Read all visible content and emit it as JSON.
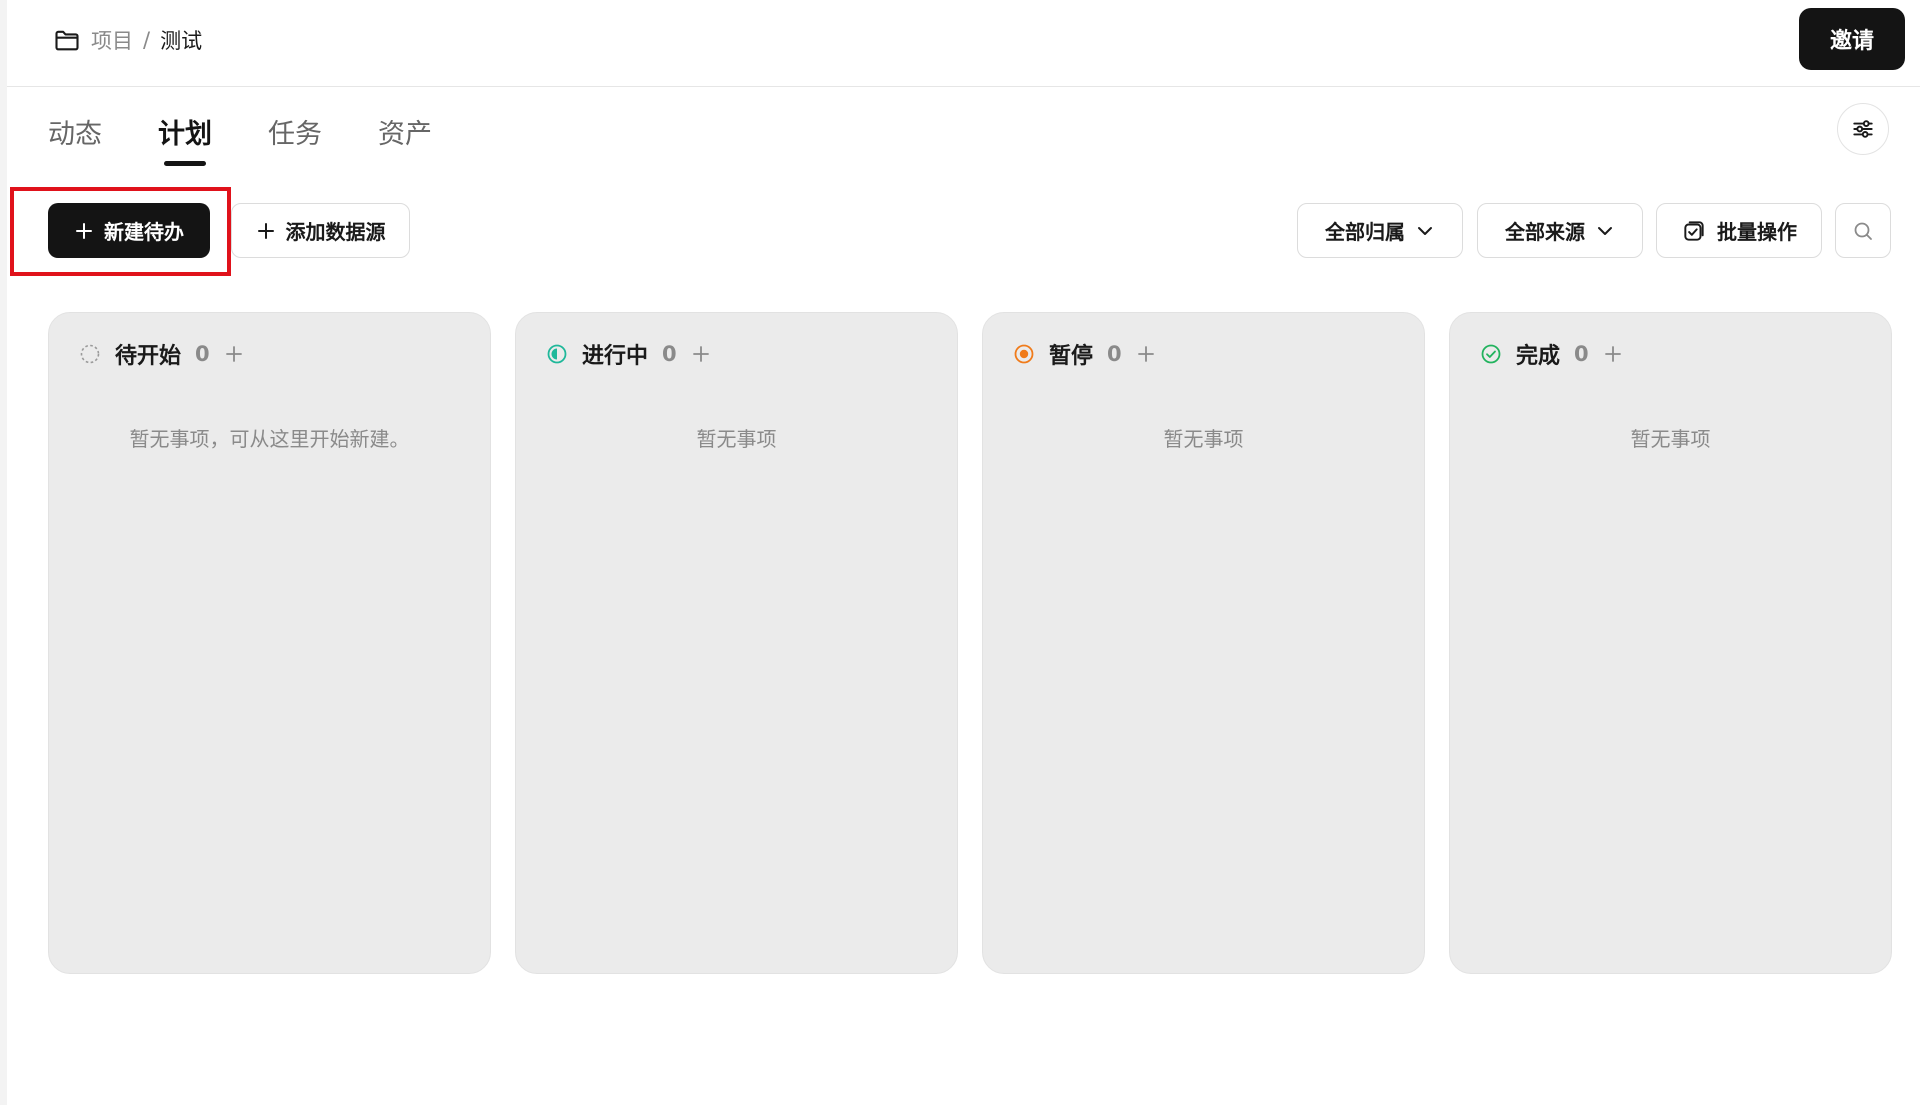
{
  "breadcrumb": {
    "root": "项目",
    "separator": "/",
    "current": "测试"
  },
  "header": {
    "invite_label": "邀请"
  },
  "tabs": [
    {
      "label": "动态",
      "active": false
    },
    {
      "label": "计划",
      "active": true
    },
    {
      "label": "任务",
      "active": false
    },
    {
      "label": "资产",
      "active": false
    }
  ],
  "toolbar": {
    "new_todo_label": "新建待办",
    "add_source_label": "添加数据源",
    "owner_filter_label": "全部归属",
    "source_filter_label": "全部来源",
    "batch_label": "批量操作"
  },
  "columns": [
    {
      "title": "待开始",
      "count": "0",
      "empty_text": "暂无事项，可从这里开始新建。",
      "status_icon": "dashed-circle-icon",
      "color": "#9a9a9a"
    },
    {
      "title": "进行中",
      "count": "0",
      "empty_text": "暂无事项",
      "status_icon": "half-circle-icon",
      "color": "#1fb89a"
    },
    {
      "title": "暂停",
      "count": "0",
      "empty_text": "暂无事项",
      "status_icon": "dot-circle-icon",
      "color": "#f07b1a"
    },
    {
      "title": "完成",
      "count": "0",
      "empty_text": "暂无事项",
      "status_icon": "check-circle-icon",
      "color": "#22b35e"
    }
  ],
  "highlight_color": "#e0121b"
}
